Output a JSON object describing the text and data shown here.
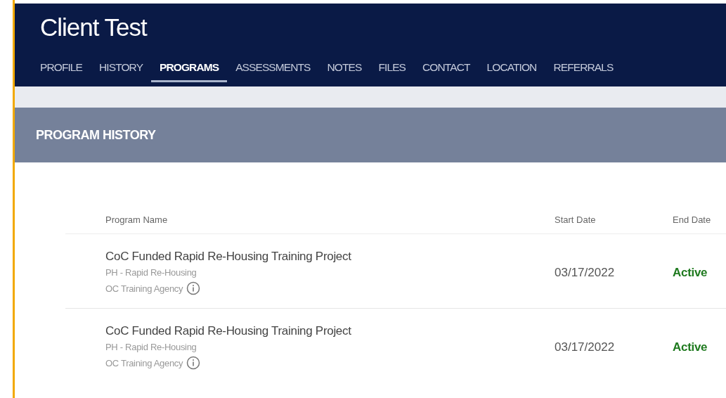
{
  "header": {
    "title": "Client Test"
  },
  "tabs": [
    {
      "label": "PROFILE",
      "selected": false
    },
    {
      "label": "HISTORY",
      "selected": false
    },
    {
      "label": "PROGRAMS",
      "selected": true
    },
    {
      "label": "ASSESSMENTS",
      "selected": false
    },
    {
      "label": "NOTES",
      "selected": false
    },
    {
      "label": "FILES",
      "selected": false
    },
    {
      "label": "CONTACT",
      "selected": false
    },
    {
      "label": "LOCATION",
      "selected": false
    },
    {
      "label": "REFERRALS",
      "selected": false
    }
  ],
  "section": {
    "title": "PROGRAM HISTORY"
  },
  "table": {
    "columns": [
      "Program Name",
      "Start Date",
      "End Date"
    ],
    "rows": [
      {
        "program_name": "CoC Funded Rapid Re-Housing Training Project",
        "project_type": "PH - Rapid Re-Housing",
        "agency": "OC Training Agency",
        "start_date": "03/17/2022",
        "end_date": "Active"
      },
      {
        "program_name": "CoC Funded Rapid Re-Housing Training Project",
        "project_type": "PH - Rapid Re-Housing",
        "agency": "OC Training Agency",
        "start_date": "03/17/2022",
        "end_date": "Active"
      }
    ]
  }
}
